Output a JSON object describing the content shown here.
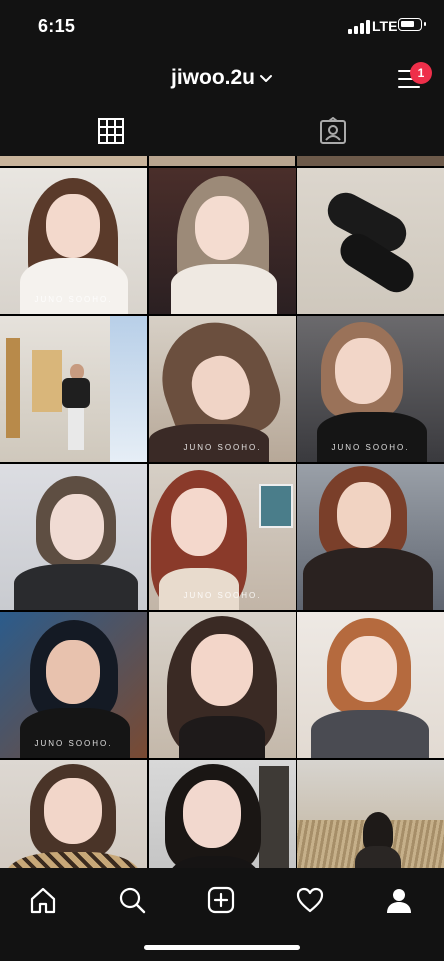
{
  "status_bar": {
    "time": "6:15",
    "network": "LTE"
  },
  "header": {
    "username": "jiwoo.2u",
    "notification_count": "1"
  },
  "tabs": [
    {
      "name": "grid",
      "icon": "grid-icon",
      "active": true
    },
    {
      "name": "tagged",
      "icon": "tagged-person-icon",
      "active": false
    }
  ],
  "grid": {
    "watermark": "JUNO SOOHO.",
    "posts": [
      {
        "watermark": true
      },
      {
        "watermark": false
      },
      {
        "watermark": false
      },
      {
        "watermark": false
      },
      {
        "watermark": true
      },
      {
        "watermark": true
      },
      {
        "watermark": false
      },
      {
        "watermark": true
      },
      {
        "watermark": false
      },
      {
        "watermark": true
      },
      {
        "watermark": false
      },
      {
        "watermark": false
      },
      {
        "watermark": false
      },
      {
        "watermark": false
      },
      {
        "watermark": false
      }
    ]
  },
  "bottom_nav": [
    {
      "name": "home",
      "icon": "home-icon"
    },
    {
      "name": "search",
      "icon": "search-icon"
    },
    {
      "name": "new-post",
      "icon": "add-post-icon"
    },
    {
      "name": "activity",
      "icon": "heart-icon"
    },
    {
      "name": "profile",
      "icon": "profile-icon",
      "active": true
    }
  ]
}
